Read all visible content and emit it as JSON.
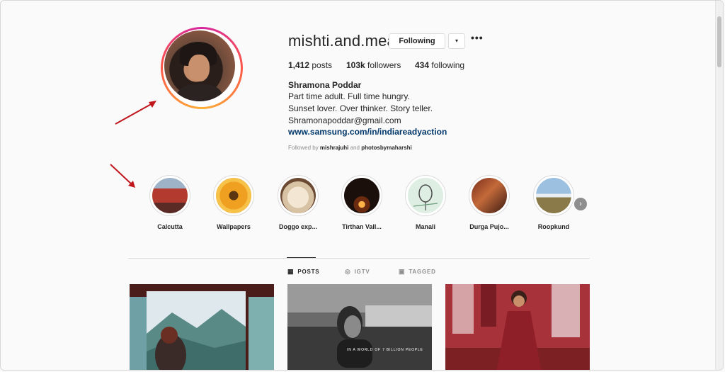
{
  "profile": {
    "username": "mishti.and.meat",
    "following_button": "Following",
    "dropdown_icon": "▾",
    "more_icon": "•••",
    "stats": [
      {
        "value": "1,412",
        "label": "posts"
      },
      {
        "value": "103k",
        "label": "followers"
      },
      {
        "value": "434",
        "label": "following"
      }
    ],
    "full_name": "Shramona Poddar",
    "bio_lines": [
      "Part time adult. Full time hungry.",
      "Sunset lover. Over thinker. Story teller.",
      "Shramonapoddar@gmail.com"
    ],
    "link": "www.samsung.com/in/indiareadyaction",
    "followed_by_prefix": "Followed by",
    "followed_by_user1": "mishrajuhi",
    "followed_by_and": "and",
    "followed_by_user2": "photosbymaharshi"
  },
  "highlights": [
    {
      "label": "Calcutta"
    },
    {
      "label": "Wallpapers"
    },
    {
      "label": "Doggo exp..."
    },
    {
      "label": "Tirthan Vall..."
    },
    {
      "label": "Manali"
    },
    {
      "label": "Durga Pujo..."
    },
    {
      "label": "Roopkund"
    }
  ],
  "tabs": [
    {
      "label": "POSTS",
      "icon": "grid-icon",
      "active": true
    },
    {
      "label": "IGTV",
      "icon": "igtv-icon",
      "active": false
    },
    {
      "label": "TAGGED",
      "icon": "tag-icon",
      "active": false
    }
  ],
  "posts": [
    {
      "caption": ""
    },
    {
      "caption": "IN A WORLD OF 7 BILLION PEOPLE"
    },
    {
      "caption": ""
    }
  ],
  "colors": {
    "link": "#00376b",
    "arrow": "#c0151b",
    "ring_start": "#d6249f",
    "ring_end": "#fdb035"
  }
}
